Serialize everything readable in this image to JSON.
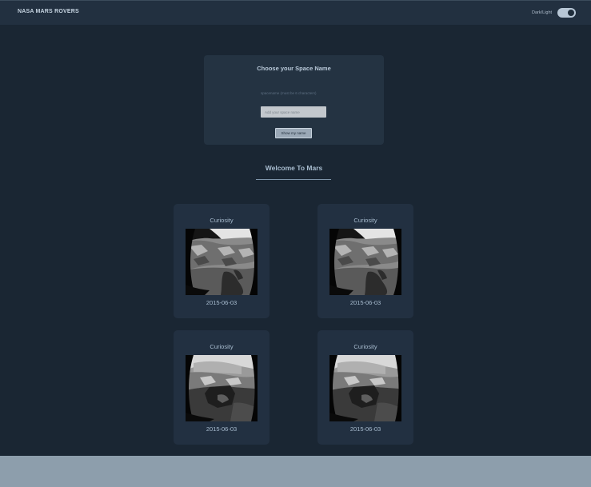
{
  "header": {
    "brand": "NASA MARS ROVERS",
    "theme_toggle_label": "Dark/Light"
  },
  "space_name": {
    "title": "Choose your Space Name",
    "hint": "spacename (must be 6 characters)",
    "input_value": "",
    "input_placeholder": "Add your space name",
    "button_label": "Show my name"
  },
  "welcome": {
    "title": "Welcome To Mars"
  },
  "photos": [
    {
      "rover": "Curiosity",
      "date": "2015-06-03",
      "icon": "mars-photo"
    },
    {
      "rover": "Curiosity",
      "date": "2015-06-03",
      "icon": "mars-photo"
    },
    {
      "rover": "Curiosity",
      "date": "2015-06-03",
      "icon": "mars-photo"
    },
    {
      "rover": "Curiosity",
      "date": "2015-06-03",
      "icon": "mars-photo"
    }
  ],
  "colors": {
    "background": "#1a2633",
    "header": "#223040",
    "card": "#223041",
    "text": "#a9bdd0",
    "footer": "#8d9eac"
  }
}
